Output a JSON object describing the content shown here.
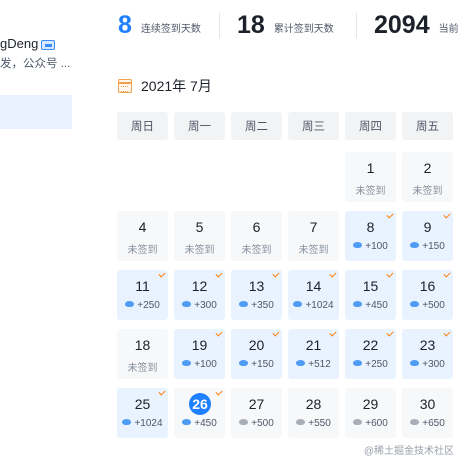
{
  "profile": {
    "username": "gDeng",
    "description": "发，公众号 ..."
  },
  "stats": [
    {
      "value": "8",
      "label": "连续签到天数"
    },
    {
      "value": "18",
      "label": "累计签到天数"
    },
    {
      "value": "2094",
      "label": "当前"
    }
  ],
  "calendar": {
    "month_title": "2021年 7月",
    "weekdays": [
      "周日",
      "周一",
      "周二",
      "周三",
      "周四",
      "周五"
    ],
    "unsigned_label": "未签到",
    "days": [
      {
        "day": "1",
        "col": 4,
        "row": 0,
        "status": "unsigned",
        "points": ""
      },
      {
        "day": "2",
        "col": 5,
        "row": 0,
        "status": "unsigned",
        "points": ""
      },
      {
        "day": "4",
        "col": 0,
        "row": 1,
        "status": "unsigned",
        "points": ""
      },
      {
        "day": "5",
        "col": 1,
        "row": 1,
        "status": "unsigned",
        "points": ""
      },
      {
        "day": "6",
        "col": 2,
        "row": 1,
        "status": "unsigned",
        "points": ""
      },
      {
        "day": "7",
        "col": 3,
        "row": 1,
        "status": "unsigned",
        "points": ""
      },
      {
        "day": "8",
        "col": 4,
        "row": 1,
        "status": "signed",
        "points": "+100"
      },
      {
        "day": "9",
        "col": 5,
        "row": 1,
        "status": "signed",
        "points": "+150"
      },
      {
        "day": "11",
        "col": 0,
        "row": 2,
        "status": "signed",
        "points": "+250"
      },
      {
        "day": "12",
        "col": 1,
        "row": 2,
        "status": "signed",
        "points": "+300"
      },
      {
        "day": "13",
        "col": 2,
        "row": 2,
        "status": "signed",
        "points": "+350"
      },
      {
        "day": "14",
        "col": 3,
        "row": 2,
        "status": "signed",
        "points": "+1024"
      },
      {
        "day": "15",
        "col": 4,
        "row": 2,
        "status": "signed",
        "points": "+450"
      },
      {
        "day": "16",
        "col": 5,
        "row": 2,
        "status": "signed",
        "points": "+500"
      },
      {
        "day": "18",
        "col": 0,
        "row": 3,
        "status": "unsigned",
        "points": ""
      },
      {
        "day": "19",
        "col": 1,
        "row": 3,
        "status": "signed",
        "points": "+100"
      },
      {
        "day": "20",
        "col": 2,
        "row": 3,
        "status": "signed",
        "points": "+150"
      },
      {
        "day": "21",
        "col": 3,
        "row": 3,
        "status": "signed",
        "points": "+512"
      },
      {
        "day": "22",
        "col": 4,
        "row": 3,
        "status": "signed",
        "points": "+250"
      },
      {
        "day": "23",
        "col": 5,
        "row": 3,
        "status": "signed",
        "points": "+300"
      },
      {
        "day": "25",
        "col": 0,
        "row": 4,
        "status": "signed",
        "points": "+1024"
      },
      {
        "day": "26",
        "col": 1,
        "row": 4,
        "status": "today",
        "points": "+450"
      },
      {
        "day": "27",
        "col": 2,
        "row": 4,
        "status": "upcoming",
        "points": "+500"
      },
      {
        "day": "28",
        "col": 3,
        "row": 4,
        "status": "upcoming",
        "points": "+550"
      },
      {
        "day": "29",
        "col": 4,
        "row": 4,
        "status": "upcoming",
        "points": "+600"
      },
      {
        "day": "30",
        "col": 5,
        "row": 4,
        "status": "upcoming",
        "points": "+650"
      }
    ]
  },
  "watermark": "@稀土掘金技术社区",
  "colors": {
    "accent": "#1e80ff",
    "signed_bg": "#e8f3ff",
    "check": "#ff7a00"
  }
}
